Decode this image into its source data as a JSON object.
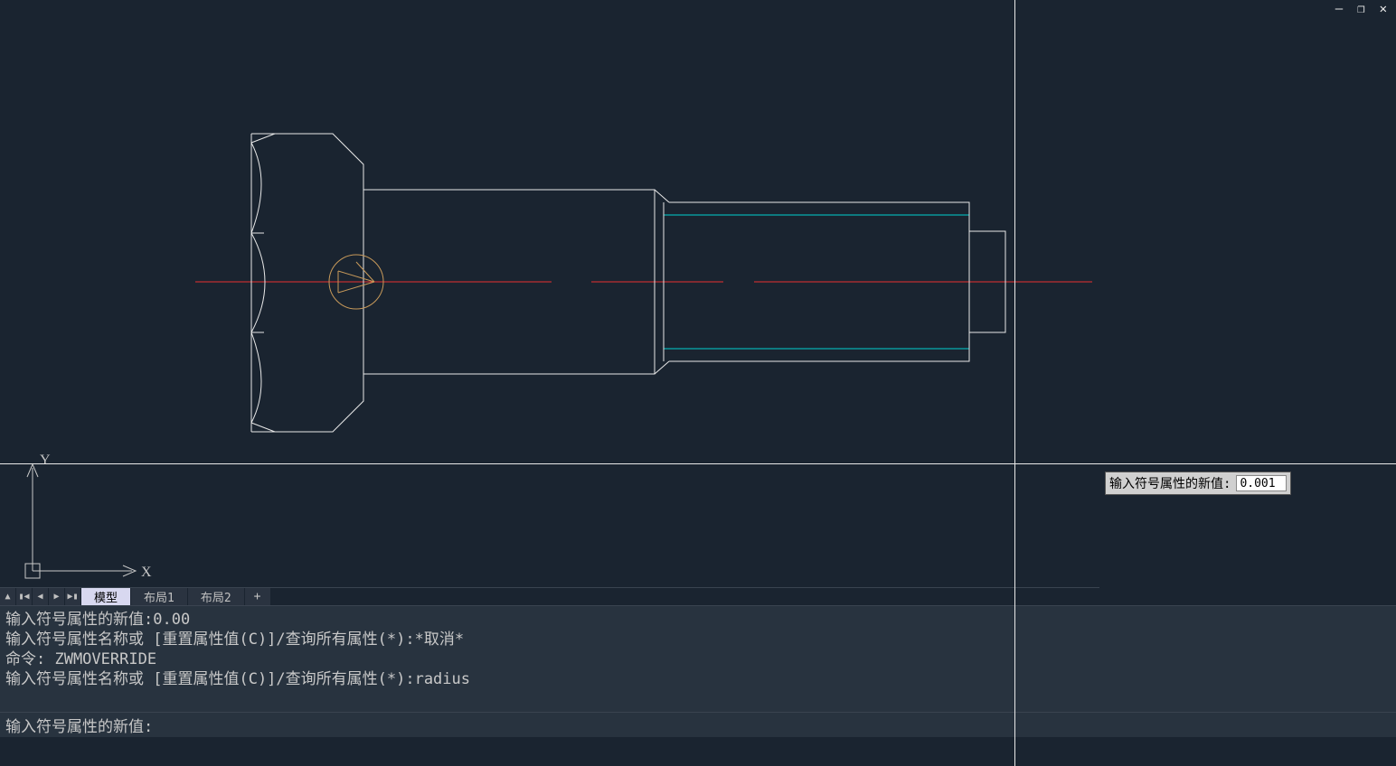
{
  "window_controls": {
    "minimize": "—",
    "maximize": "❐",
    "close": "✕"
  },
  "ucs": {
    "x_label": "X",
    "y_label": "Y"
  },
  "dyn_input": {
    "label": "输入符号属性的新值:",
    "value": "0.001"
  },
  "tabs": {
    "model": "模型",
    "layout1": "布局1",
    "layout2": "布局2",
    "plus": "+"
  },
  "cmd_history": [
    "输入符号属性的新值:0.00",
    "输入符号属性名称或 [重置属性值(C)]/查询所有属性(*):*取消*",
    "命令: ZWMOVERRIDE",
    "输入符号属性名称或 [重置属性值(C)]/查询所有属性(*):radius"
  ],
  "cmd_prompt": "输入符号属性的新值:",
  "cmd_value": ""
}
